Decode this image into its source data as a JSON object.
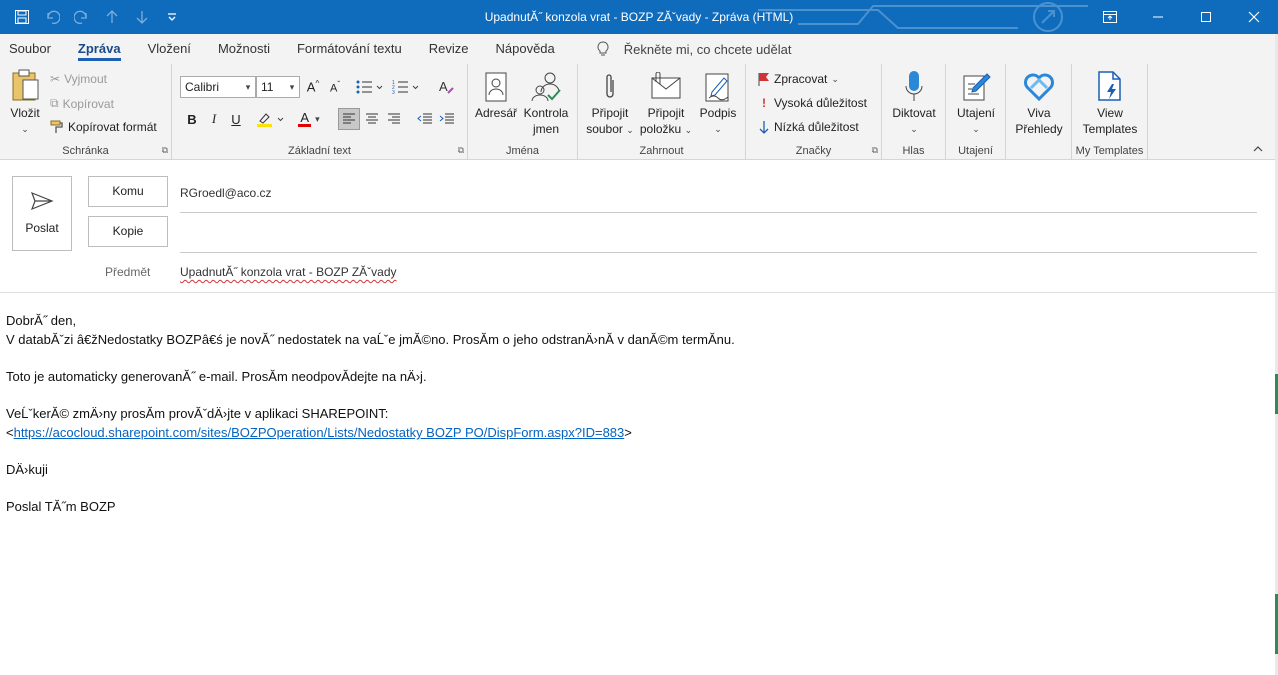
{
  "window": {
    "title": "UpadnutĂ˝ konzola vrat - BOZP ZĂˇvady  -  Zpráva (HTML)",
    "colors": {
      "titlebar": "#0f6cbd",
      "ribbon": "#f3f3f3",
      "accent": "#1a5fb4",
      "link": "#0563c1"
    }
  },
  "tabs": [
    {
      "label": "Soubor"
    },
    {
      "label": "Zpráva"
    },
    {
      "label": "Vložení"
    },
    {
      "label": "Možnosti"
    },
    {
      "label": "Formátování textu"
    },
    {
      "label": "Revize"
    },
    {
      "label": "Nápověda"
    }
  ],
  "tellme": {
    "placeholder": "Řekněte mi, co chcete udělat"
  },
  "ribbon": {
    "clipboard": {
      "label": "Schránka",
      "paste": "Vložit",
      "cut": "Vyjmout",
      "copy": "Kopírovat",
      "format_painter": "Kopírovat formát"
    },
    "basic_text": {
      "label": "Základní text",
      "font_name": "Calibri",
      "font_size": "11",
      "bold": "B",
      "italic": "I",
      "underline": "U",
      "font_color_letter": "A"
    },
    "names": {
      "label": "Jména",
      "address_book": "Adresář",
      "check_names_1": "Kontrola",
      "check_names_2": "jmen"
    },
    "include": {
      "label": "Zahrnout",
      "attach_file_1": "Připojit",
      "attach_file_2": "soubor",
      "attach_item_1": "Připojit",
      "attach_item_2": "položku",
      "signature": "Podpis"
    },
    "tags": {
      "label": "Značky",
      "follow_up": "Zpracovat",
      "high_importance": "Vysoká důležitost",
      "low_importance": "Nízká důležitost"
    },
    "voice": {
      "label": "Hlas",
      "dictate": "Diktovat"
    },
    "sensitivity": {
      "label": "Utajení",
      "button": "Utajení"
    },
    "viva": {
      "line1": "Viva",
      "line2": "Přehledy"
    },
    "templates": {
      "label": "My Templates",
      "line1": "View",
      "line2": "Templates"
    }
  },
  "compose": {
    "send": "Poslat",
    "to_label": "Komu",
    "to_value": "RGroedl@aco.cz",
    "cc_label": "Kopie",
    "cc_value": "",
    "subject_label": "Předmět",
    "subject_value": "UpadnutĂ˝ konzola vrat - BOZP ZĂˇvady"
  },
  "body": {
    "greeting": "DobrĂ˝ den,",
    "line1": "V databĂˇzi â€žNedostatky BOZPâ€ś je novĂ˝ nedostatek na vaĹˇe jmĂ©no. ProsĂm o jeho odstranÄ›nĂ v danĂ©m termĂnu.",
    "line2": "Toto je automaticky generovanĂ˝ e-mail. ProsĂm neodpovĂdejte na nÄ›j.",
    "line3": "VeĹˇkerĂ© zmÄ›ny prosĂm provĂˇdÄ›jte v aplikaci SHAREPOINT:",
    "link_open": "<",
    "link": "https://acocloud.sharepoint.com/sites/BOZPOperation/Lists/Nedostatky BOZP PO/DispForm.aspx?ID=883",
    "link_close": ">",
    "thanks": "DÄ›kuji",
    "signature": "Poslal TĂ˝m BOZP"
  }
}
